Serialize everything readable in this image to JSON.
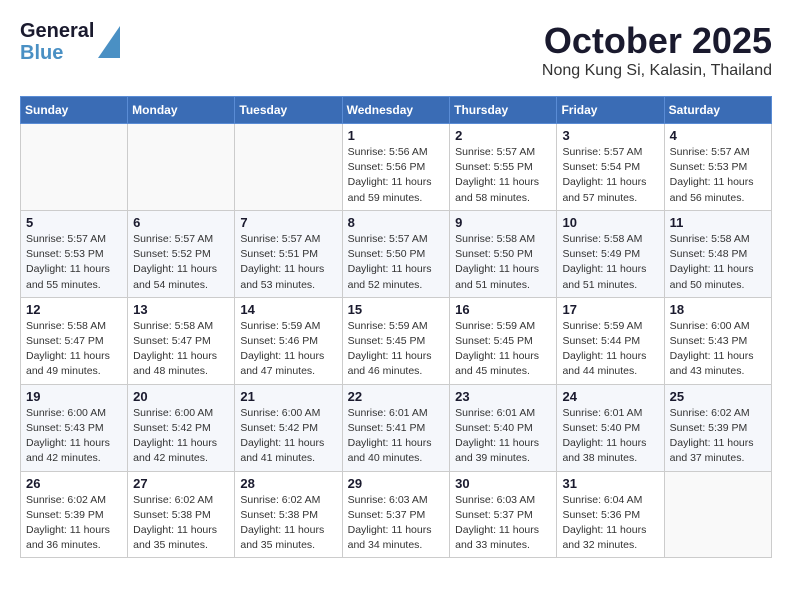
{
  "header": {
    "logo_general": "General",
    "logo_blue": "Blue",
    "month_title": "October 2025",
    "location": "Nong Kung Si, Kalasin, Thailand"
  },
  "weekdays": [
    "Sunday",
    "Monday",
    "Tuesday",
    "Wednesday",
    "Thursday",
    "Friday",
    "Saturday"
  ],
  "weeks": [
    [
      {
        "day": "",
        "detail": ""
      },
      {
        "day": "",
        "detail": ""
      },
      {
        "day": "",
        "detail": ""
      },
      {
        "day": "1",
        "detail": "Sunrise: 5:56 AM\nSunset: 5:56 PM\nDaylight: 11 hours\nand 59 minutes."
      },
      {
        "day": "2",
        "detail": "Sunrise: 5:57 AM\nSunset: 5:55 PM\nDaylight: 11 hours\nand 58 minutes."
      },
      {
        "day": "3",
        "detail": "Sunrise: 5:57 AM\nSunset: 5:54 PM\nDaylight: 11 hours\nand 57 minutes."
      },
      {
        "day": "4",
        "detail": "Sunrise: 5:57 AM\nSunset: 5:53 PM\nDaylight: 11 hours\nand 56 minutes."
      }
    ],
    [
      {
        "day": "5",
        "detail": "Sunrise: 5:57 AM\nSunset: 5:53 PM\nDaylight: 11 hours\nand 55 minutes."
      },
      {
        "day": "6",
        "detail": "Sunrise: 5:57 AM\nSunset: 5:52 PM\nDaylight: 11 hours\nand 54 minutes."
      },
      {
        "day": "7",
        "detail": "Sunrise: 5:57 AM\nSunset: 5:51 PM\nDaylight: 11 hours\nand 53 minutes."
      },
      {
        "day": "8",
        "detail": "Sunrise: 5:57 AM\nSunset: 5:50 PM\nDaylight: 11 hours\nand 52 minutes."
      },
      {
        "day": "9",
        "detail": "Sunrise: 5:58 AM\nSunset: 5:50 PM\nDaylight: 11 hours\nand 51 minutes."
      },
      {
        "day": "10",
        "detail": "Sunrise: 5:58 AM\nSunset: 5:49 PM\nDaylight: 11 hours\nand 51 minutes."
      },
      {
        "day": "11",
        "detail": "Sunrise: 5:58 AM\nSunset: 5:48 PM\nDaylight: 11 hours\nand 50 minutes."
      }
    ],
    [
      {
        "day": "12",
        "detail": "Sunrise: 5:58 AM\nSunset: 5:47 PM\nDaylight: 11 hours\nand 49 minutes."
      },
      {
        "day": "13",
        "detail": "Sunrise: 5:58 AM\nSunset: 5:47 PM\nDaylight: 11 hours\nand 48 minutes."
      },
      {
        "day": "14",
        "detail": "Sunrise: 5:59 AM\nSunset: 5:46 PM\nDaylight: 11 hours\nand 47 minutes."
      },
      {
        "day": "15",
        "detail": "Sunrise: 5:59 AM\nSunset: 5:45 PM\nDaylight: 11 hours\nand 46 minutes."
      },
      {
        "day": "16",
        "detail": "Sunrise: 5:59 AM\nSunset: 5:45 PM\nDaylight: 11 hours\nand 45 minutes."
      },
      {
        "day": "17",
        "detail": "Sunrise: 5:59 AM\nSunset: 5:44 PM\nDaylight: 11 hours\nand 44 minutes."
      },
      {
        "day": "18",
        "detail": "Sunrise: 6:00 AM\nSunset: 5:43 PM\nDaylight: 11 hours\nand 43 minutes."
      }
    ],
    [
      {
        "day": "19",
        "detail": "Sunrise: 6:00 AM\nSunset: 5:43 PM\nDaylight: 11 hours\nand 42 minutes."
      },
      {
        "day": "20",
        "detail": "Sunrise: 6:00 AM\nSunset: 5:42 PM\nDaylight: 11 hours\nand 42 minutes."
      },
      {
        "day": "21",
        "detail": "Sunrise: 6:00 AM\nSunset: 5:42 PM\nDaylight: 11 hours\nand 41 minutes."
      },
      {
        "day": "22",
        "detail": "Sunrise: 6:01 AM\nSunset: 5:41 PM\nDaylight: 11 hours\nand 40 minutes."
      },
      {
        "day": "23",
        "detail": "Sunrise: 6:01 AM\nSunset: 5:40 PM\nDaylight: 11 hours\nand 39 minutes."
      },
      {
        "day": "24",
        "detail": "Sunrise: 6:01 AM\nSunset: 5:40 PM\nDaylight: 11 hours\nand 38 minutes."
      },
      {
        "day": "25",
        "detail": "Sunrise: 6:02 AM\nSunset: 5:39 PM\nDaylight: 11 hours\nand 37 minutes."
      }
    ],
    [
      {
        "day": "26",
        "detail": "Sunrise: 6:02 AM\nSunset: 5:39 PM\nDaylight: 11 hours\nand 36 minutes."
      },
      {
        "day": "27",
        "detail": "Sunrise: 6:02 AM\nSunset: 5:38 PM\nDaylight: 11 hours\nand 35 minutes."
      },
      {
        "day": "28",
        "detail": "Sunrise: 6:02 AM\nSunset: 5:38 PM\nDaylight: 11 hours\nand 35 minutes."
      },
      {
        "day": "29",
        "detail": "Sunrise: 6:03 AM\nSunset: 5:37 PM\nDaylight: 11 hours\nand 34 minutes."
      },
      {
        "day": "30",
        "detail": "Sunrise: 6:03 AM\nSunset: 5:37 PM\nDaylight: 11 hours\nand 33 minutes."
      },
      {
        "day": "31",
        "detail": "Sunrise: 6:04 AM\nSunset: 5:36 PM\nDaylight: 11 hours\nand 32 minutes."
      },
      {
        "day": "",
        "detail": ""
      }
    ]
  ]
}
